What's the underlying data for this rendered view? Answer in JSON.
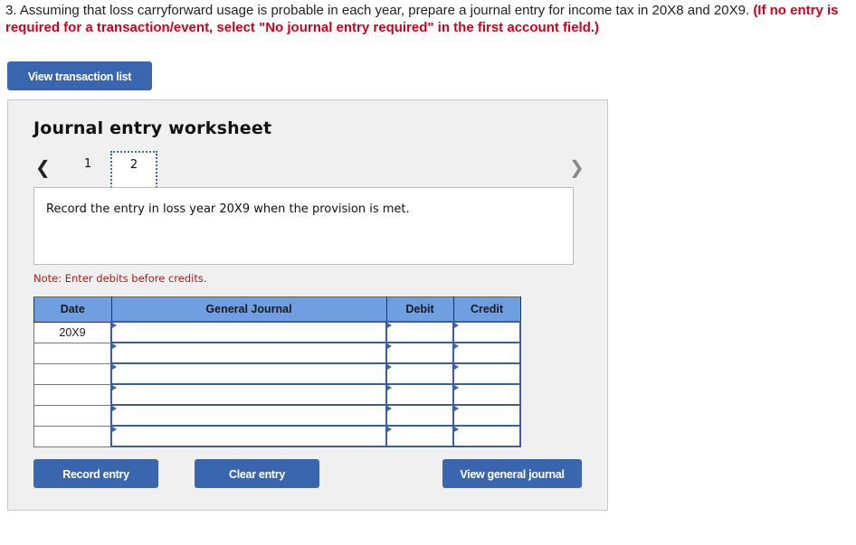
{
  "question": {
    "text": "3. Assuming that loss carryforward usage is probable in each year, prepare a journal entry for income tax in 20X8 and 20X9.",
    "instruction": "(If no entry is required for a transaction/event, select \"No journal entry required\" in the first account field.)"
  },
  "buttons": {
    "view_transaction_list": "View transaction list",
    "record_entry": "Record entry",
    "clear_entry": "Clear entry",
    "view_general_journal": "View general journal"
  },
  "worksheet": {
    "title": "Journal entry worksheet",
    "prev_icon": "‹",
    "next_icon": "›",
    "pages": [
      "1",
      "2"
    ],
    "active_page": "2",
    "description": "Record the entry in loss year 20X9 when the provision is met.",
    "note": "Note: Enter debits before credits."
  },
  "table": {
    "headers": [
      "Date",
      "General Journal",
      "Debit",
      "Credit"
    ],
    "rows": [
      {
        "date": "20X9",
        "account": "",
        "debit": "",
        "credit": ""
      },
      {
        "date": "",
        "account": "",
        "debit": "",
        "credit": ""
      },
      {
        "date": "",
        "account": "",
        "debit": "",
        "credit": ""
      },
      {
        "date": "",
        "account": "",
        "debit": "",
        "credit": ""
      },
      {
        "date": "",
        "account": "",
        "debit": "",
        "credit": ""
      },
      {
        "date": "",
        "account": "",
        "debit": "",
        "credit": ""
      }
    ]
  },
  "colors": {
    "accent": "#3a66b0",
    "header_bg": "#6f9fe0",
    "instruction_red": "#d0021b",
    "note_red": "#b01c1c"
  }
}
